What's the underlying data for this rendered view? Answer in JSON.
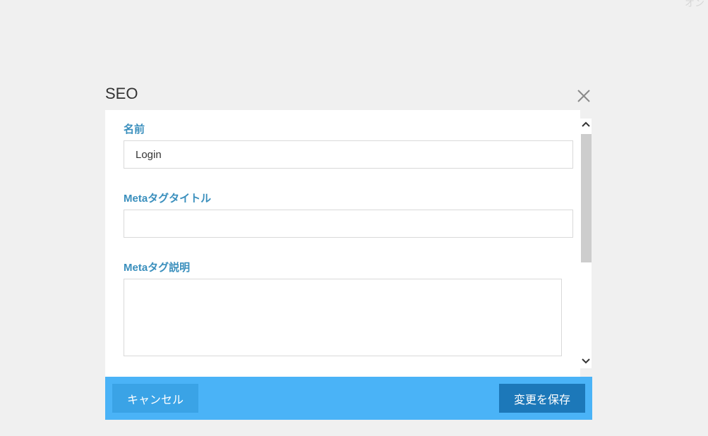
{
  "background": {
    "fragment_text": "オン"
  },
  "modal": {
    "title": "SEO",
    "close_icon": "close-icon",
    "fields": {
      "name": {
        "label": "名前",
        "value": "Login",
        "placeholder": ""
      },
      "meta_title": {
        "label": "Metaタグタイトル",
        "value": "",
        "placeholder": ""
      },
      "meta_description": {
        "label": "Metaタグ説明",
        "value": "",
        "placeholder": ""
      }
    },
    "footer": {
      "cancel_label": "キャンセル",
      "save_label": "変更を保存"
    }
  },
  "colors": {
    "label": "#3a8fbd",
    "footer": "#4ab3f7",
    "cancel_button": "#3aa3e6",
    "save_button": "#1c78b9",
    "page_background": "#f0f0f0"
  }
}
